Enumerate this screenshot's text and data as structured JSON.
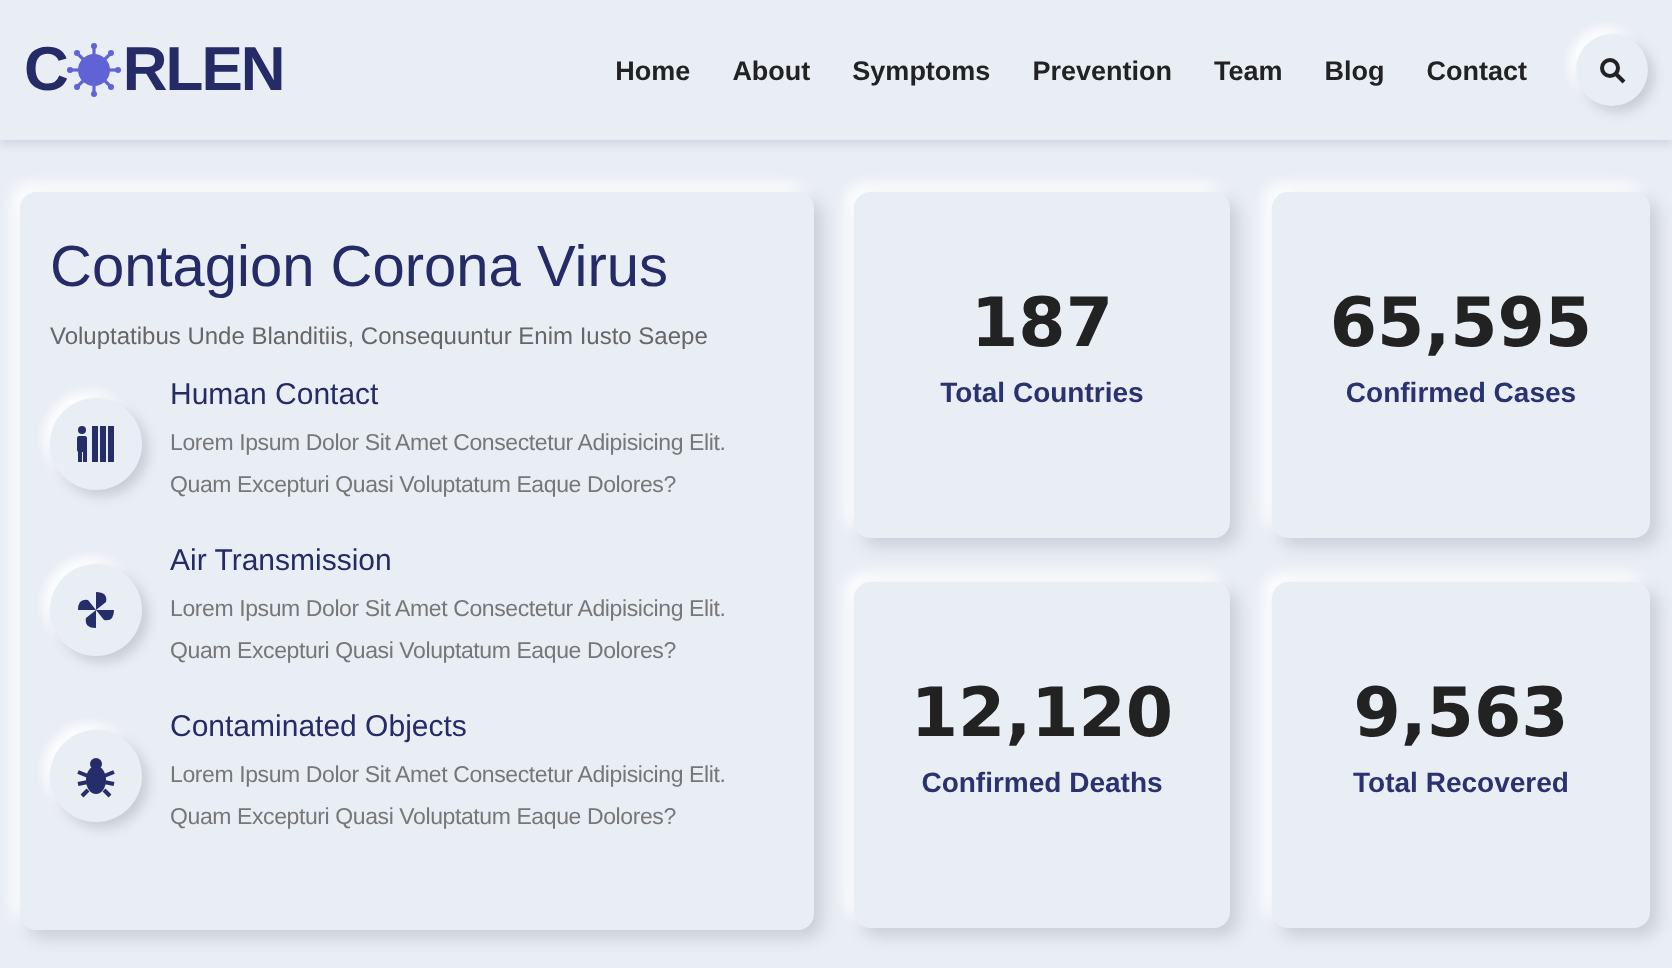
{
  "logo": {
    "lead": "C",
    "rest": "RLEN"
  },
  "nav": [
    {
      "label": "Home"
    },
    {
      "label": "About"
    },
    {
      "label": "Symptoms"
    },
    {
      "label": "Prevention"
    },
    {
      "label": "Team"
    },
    {
      "label": "Blog"
    },
    {
      "label": "Contact"
    }
  ],
  "intro": {
    "title": "Contagion Corona Virus",
    "subtitle": "Voluptatibus Unde Blanditiis, Consequuntur Enim Iusto Saepe",
    "features": [
      {
        "title": "Human Contact",
        "text": "Lorem Ipsum Dolor Sit Amet Consectetur Adipisicing Elit. Quam Excepturi Quasi Voluptatum Eaque Dolores?"
      },
      {
        "title": "Air Transmission",
        "text": "Lorem Ipsum Dolor Sit Amet Consectetur Adipisicing Elit. Quam Excepturi Quasi Voluptatum Eaque Dolores?"
      },
      {
        "title": "Contaminated Objects",
        "text": "Lorem Ipsum Dolor Sit Amet Consectetur Adipisicing Elit. Quam Excepturi Quasi Voluptatum Eaque Dolores?"
      }
    ]
  },
  "stats": [
    {
      "value": "187",
      "label": "Total Countries"
    },
    {
      "value": "65,595",
      "label": "Confirmed Cases"
    },
    {
      "value": "12,120",
      "label": "Confirmed Deaths"
    },
    {
      "value": "9,563",
      "label": "Total Recovered"
    }
  ]
}
